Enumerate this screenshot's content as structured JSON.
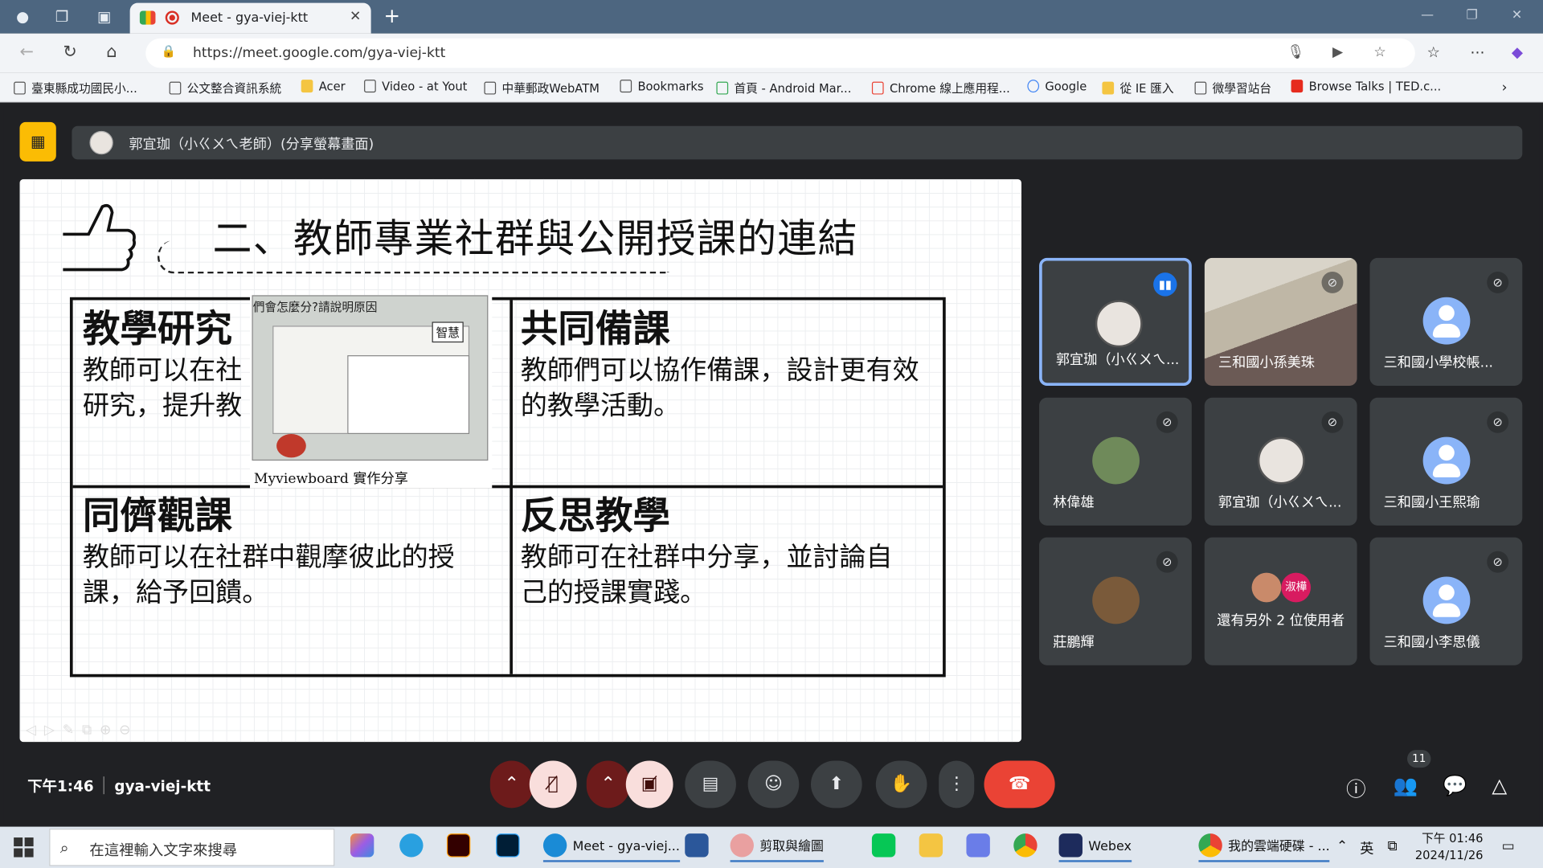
{
  "browser": {
    "tab_title": "Meet - gya-viej-ktt",
    "url": "https://meet.google.com/gya-viej-ktt",
    "bookmarks": [
      "臺東縣成功國民小...",
      "公文整合資訊系統",
      "Acer",
      "Video - at Yout",
      "中華郵政WebATM",
      "Bookmarks",
      "首頁 - Android Mar...",
      "Chrome 線上應用程...",
      "Google",
      "從 IE 匯入",
      "微學習站台",
      "Browse Talks | TED.c..."
    ]
  },
  "presenter": {
    "label": "郭宜珈（小ㄍㄨㄟ老師）(分享螢幕畫面)"
  },
  "slide": {
    "title": "二、教師專業社群與公開授課的連結",
    "cells": [
      {
        "heading": "教學研究",
        "body": "教師可以在社群中進行教學研究，提升教學品質。"
      },
      {
        "heading": "共同備課",
        "body": "教師們可以協作備課，設計更有效的教學活動。"
      },
      {
        "heading": "同儕觀課",
        "body": "教師可以在社群中觀摩彼此的授課，給予回饋。"
      },
      {
        "heading": "反思教學",
        "body": "教師可在社群中分享，並討論自己的授課實踐。"
      }
    ],
    "cell_body_visible": [
      "教師可以在社",
      "研究，提升教"
    ],
    "pip": {
      "question": "們會怎麼分?請說明原因",
      "caption": "Myviewboard 實作分享",
      "board_text": "智慧"
    }
  },
  "participants": [
    {
      "name": "郭宜珈（小ㄍㄨㄟ...",
      "state": "speaking"
    },
    {
      "name": "三和國小孫美珠",
      "state": "muted"
    },
    {
      "name": "三和國小學校帳...",
      "state": "muted"
    },
    {
      "name": "林偉雄",
      "state": "muted"
    },
    {
      "name": "郭宜珈（小ㄍㄨㄟ...",
      "state": "muted"
    },
    {
      "name": "三和國小王熙瑜",
      "state": "muted"
    },
    {
      "name": "莊鵬輝",
      "state": "muted"
    },
    {
      "name": "還有另外 2 位使用者",
      "state": "others",
      "avatar_text": "淑樺"
    },
    {
      "name": "三和國小李思儀",
      "state": "muted"
    }
  ],
  "meeting": {
    "time": "下午1:46",
    "code": "gya-viej-ktt",
    "people_count": "11"
  },
  "taskbar": {
    "search_placeholder": "在這裡輸入文字來搜尋",
    "apps": [
      "Meet - gya-viej...",
      "剪取與繪圖",
      "Webex",
      "我的雲端硬碟 - ..."
    ],
    "ime": "英",
    "clock_time": "下午 01:46",
    "clock_date": "2024/11/26"
  },
  "colors": {
    "accent": "#1a73e8",
    "end_call": "#ea4335",
    "presenting": "#fbbc04",
    "tab_bar": "#4d6680"
  }
}
